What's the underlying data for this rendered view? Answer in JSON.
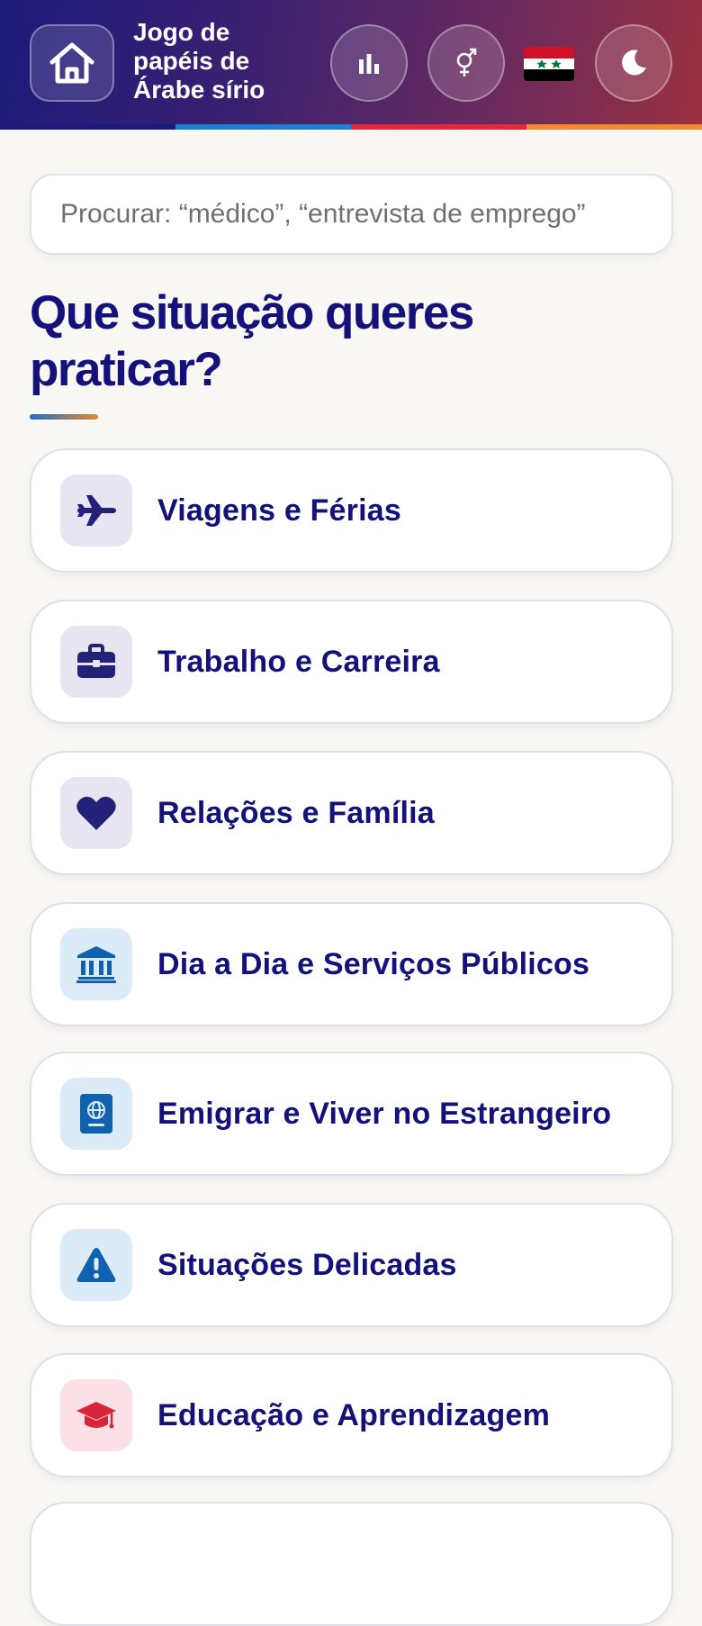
{
  "header": {
    "title": "Jogo de papéis de Árabe sírio",
    "stripe_colors": [
      "#1c1a7a",
      "#1f7fd1",
      "#e0283f",
      "#f08a2a"
    ],
    "buttons": [
      {
        "name": "home",
        "icon": "home-icon"
      },
      {
        "name": "stats",
        "icon": "bar-chart-icon"
      },
      {
        "name": "gender",
        "icon": "gender-icon"
      },
      {
        "name": "theme",
        "icon": "moon-icon"
      }
    ],
    "flag": "syria-flag"
  },
  "search": {
    "placeholder": "Procurar: “médico”, “entrevista de emprego”"
  },
  "heading": "Que situação queres praticar?",
  "categories": [
    {
      "label": "Viagens e Férias",
      "icon": "airplane-icon",
      "icon_bg": "#e6e5f1",
      "icon_color": "#232178"
    },
    {
      "label": "Trabalho e Carreira",
      "icon": "briefcase-icon",
      "icon_bg": "#e6e5f1",
      "icon_color": "#232178"
    },
    {
      "label": "Relações e Família",
      "icon": "heart-icon",
      "icon_bg": "#e6e5f1",
      "icon_color": "#232178"
    },
    {
      "label": "Dia a Dia e Serviços Públicos",
      "icon": "bank-icon",
      "icon_bg": "#dcebf8",
      "icon_color": "#1061b0"
    },
    {
      "label": "Emigrar e Viver no Estrangeiro",
      "icon": "passport-icon",
      "icon_bg": "#dcebf8",
      "icon_color": "#1061b0"
    },
    {
      "label": "Situações Delicadas",
      "icon": "warning-icon",
      "icon_bg": "#dcebf8",
      "icon_color": "#1061b0"
    },
    {
      "label": "Educação e Aprendizagem",
      "icon": "graduation-cap-icon",
      "icon_bg": "#fbe1e5",
      "icon_color": "#d9253c"
    }
  ]
}
